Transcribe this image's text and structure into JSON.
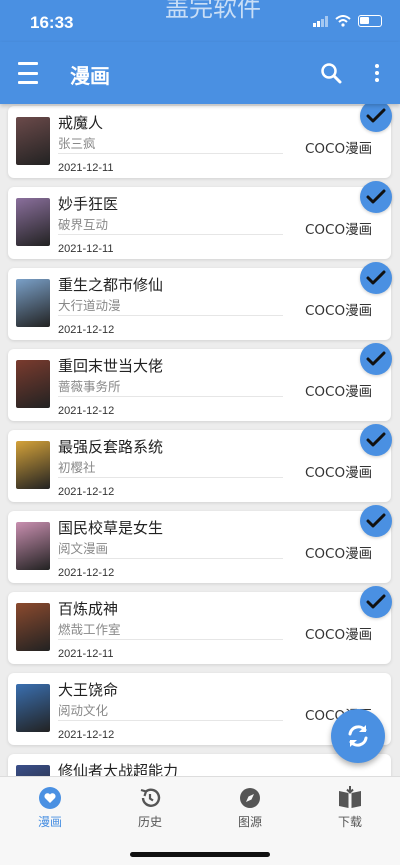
{
  "status_bar": {
    "time": "16:33",
    "watermark": "盖完软件"
  },
  "app_bar": {
    "title": "漫画"
  },
  "comics": [
    {
      "title": "戒魔人",
      "author": "张三疯",
      "date": "2021-12-11",
      "source": "COCO漫画",
      "checked": true,
      "cover_color": "#6b4a4a"
    },
    {
      "title": "妙手狂医",
      "author": "破界互动",
      "date": "2021-12-11",
      "source": "COCO漫画",
      "checked": true,
      "cover_color": "#8a6f9c"
    },
    {
      "title": "重生之都市修仙",
      "author": "大行道动漫",
      "date": "2021-12-12",
      "source": "COCO漫画",
      "checked": true,
      "cover_color": "#7aa0c8"
    },
    {
      "title": "重回末世当大佬",
      "author": "蔷薇事务所",
      "date": "2021-12-12",
      "source": "COCO漫画",
      "checked": true,
      "cover_color": "#7a3b2e"
    },
    {
      "title": "最强反套路系统",
      "author": "初樱社",
      "date": "2021-12-12",
      "source": "COCO漫画",
      "checked": true,
      "cover_color": "#d4a23a"
    },
    {
      "title": "国民校草是女生",
      "author": "阅文漫画",
      "date": "2021-12-12",
      "source": "COCO漫画",
      "checked": true,
      "cover_color": "#c98fb0"
    },
    {
      "title": "百炼成神",
      "author": "燃哉工作室",
      "date": "2021-12-11",
      "source": "COCO漫画",
      "checked": true,
      "cover_color": "#8b4a2e"
    },
    {
      "title": "大王饶命",
      "author": "阅动文化",
      "date": "2021-12-12",
      "source": "COCO漫画",
      "checked": false,
      "cover_color": "#3a6fb0"
    },
    {
      "title": "修仙者大战超能力",
      "author": "",
      "date": "",
      "source": "",
      "checked": false,
      "cover_color": "#3a4f8a"
    }
  ],
  "bottom_nav": [
    {
      "label": "漫画",
      "icon": "heart-icon",
      "active": true
    },
    {
      "label": "历史",
      "icon": "history-icon",
      "active": false
    },
    {
      "label": "图源",
      "icon": "compass-icon",
      "active": false
    },
    {
      "label": "下载",
      "icon": "book-download-icon",
      "active": false
    }
  ],
  "colors": {
    "primary": "#4a90e2",
    "background": "#ededed"
  }
}
